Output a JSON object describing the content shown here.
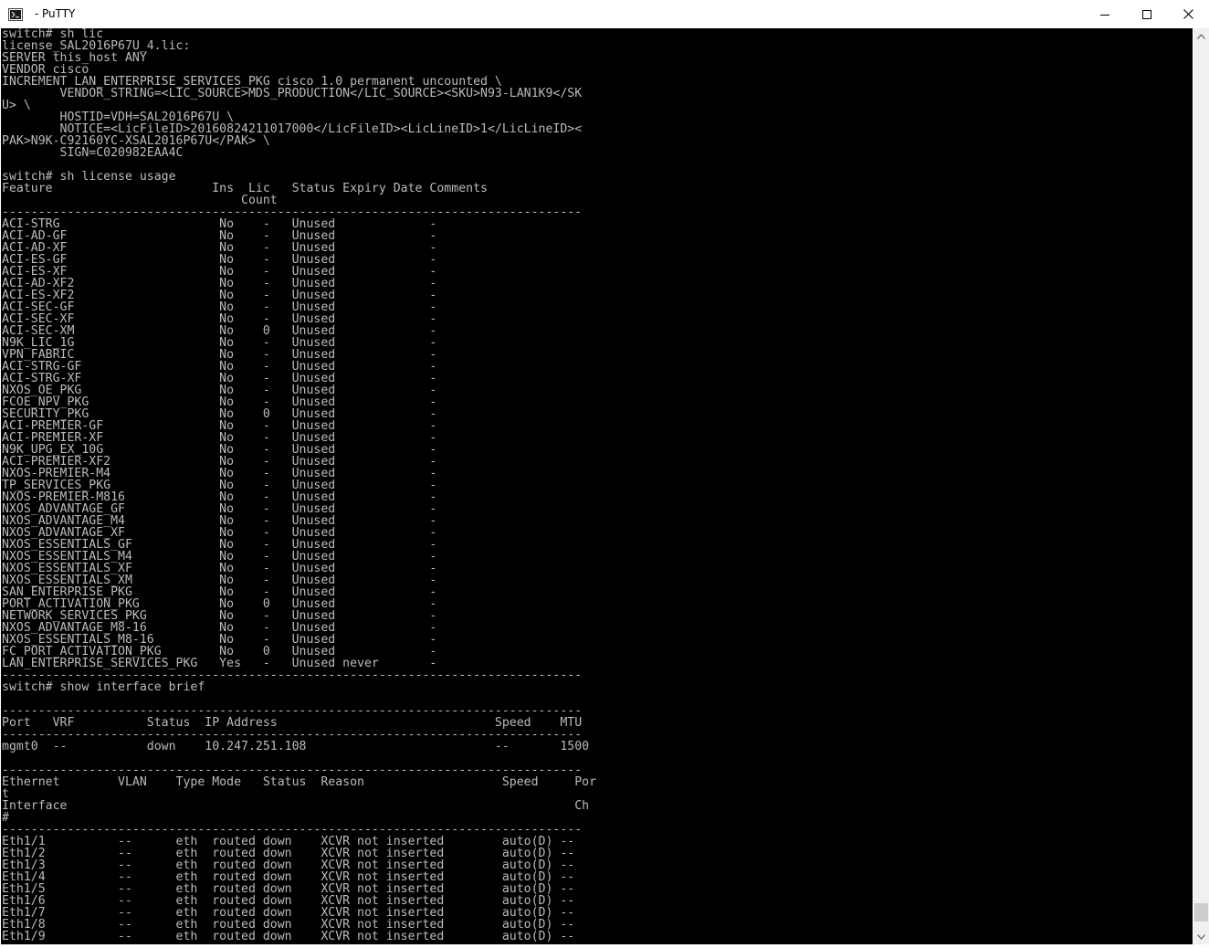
{
  "window": {
    "title": " - PuTTY",
    "app_icon": "putty-terminal-icon",
    "controls": {
      "minimize_icon": "minimize-icon",
      "maximize_icon": "maximize-icon",
      "close_icon": "close-icon"
    }
  },
  "colors": {
    "terminal_bg": "#000000",
    "terminal_fg": "#bbbbbb",
    "titlebar_bg": "#ffffff",
    "scrollbar_bg": "#f0f0f0",
    "scrollbar_thumb": "#cdcdcd"
  },
  "scrollbar": {
    "up_icon": "scroll-up-arrow-icon",
    "down_icon": "scroll-down-arrow-icon",
    "thumb_position_fraction": 0.97
  },
  "terminal": {
    "lines": [
      "switch# sh lic",
      "license_SAL2016P67U_4.lic:",
      "SERVER this_host ANY",
      "VENDOR cisco",
      "INCREMENT LAN_ENTERPRISE_SERVICES_PKG cisco 1.0 permanent uncounted \\",
      "        VENDOR_STRING=<LIC_SOURCE>MDS_PRODUCTION</LIC_SOURCE><SKU>N93-LAN1K9</SK",
      "U> \\",
      "        HOSTID=VDH=SAL2016P67U \\",
      "        NOTICE=<LicFileID>20160824211017000</LicFileID><LicLineID>1</LicLineID><",
      "PAK>N9K-C92160YC-XSAL2016P67U</PAK> \\",
      "        SIGN=C020982EAA4C",
      "",
      "switch# sh license usage",
      "Feature                      Ins  Lic   Status Expiry Date Comments",
      "                                 Count",
      "--------------------------------------------------------------------------------",
      "ACI-STRG                      No    -   Unused             -",
      "ACI-AD-GF                     No    -   Unused             -",
      "ACI-AD-XF                     No    -   Unused             -",
      "ACI-ES-GF                     No    -   Unused             -",
      "ACI-ES-XF                     No    -   Unused             -",
      "ACI-AD-XF2                    No    -   Unused             -",
      "ACI-ES-XF2                    No    -   Unused             -",
      "ACI-SEC-GF                    No    -   Unused             -",
      "ACI-SEC-XF                    No    -   Unused             -",
      "ACI-SEC-XM                    No    0   Unused             -",
      "N9K_LIC_1G                    No    -   Unused             -",
      "VPN_FABRIC                    No    -   Unused             -",
      "ACI-STRG-GF                   No    -   Unused             -",
      "ACI-STRG-XF                   No    -   Unused             -",
      "NXOS_OE_PKG                   No    -   Unused             -",
      "FCOE_NPV_PKG                  No    -   Unused             -",
      "SECURITY_PKG                  No    0   Unused             -",
      "ACI-PREMIER-GF                No    -   Unused             -",
      "ACI-PREMIER-XF                No    -   Unused             -",
      "N9K_UPG_EX_10G                No    -   Unused             -",
      "ACI-PREMIER-XF2               No    -   Unused             -",
      "NXOS-PREMIER-M4               No    -   Unused             -",
      "TP_SERVICES_PKG               No    -   Unused             -",
      "NXOS-PREMIER-M816             No    -   Unused             -",
      "NXOS_ADVANTAGE_GF             No    -   Unused             -",
      "NXOS_ADVANTAGE_M4             No    -   Unused             -",
      "NXOS_ADVANTAGE_XF             No    -   Unused             -",
      "NXOS_ESSENTIALS_GF            No    -   Unused             -",
      "NXOS_ESSENTIALS_M4            No    -   Unused             -",
      "NXOS_ESSENTIALS_XF            No    -   Unused             -",
      "NXOS_ESSENTIALS_XM            No    -   Unused             -",
      "SAN_ENTERPRISE_PKG            No    -   Unused             -",
      "PORT_ACTIVATION_PKG           No    0   Unused             -",
      "NETWORK_SERVICES_PKG          No    -   Unused             -",
      "NXOS_ADVANTAGE_M8-16          No    -   Unused             -",
      "NXOS_ESSENTIALS_M8-16         No    -   Unused             -",
      "FC_PORT_ACTIVATION_PKG        No    0   Unused             -",
      "LAN_ENTERPRISE_SERVICES_PKG   Yes   -   Unused never       -",
      "--------------------------------------------------------------------------------",
      "switch# show interface brief",
      "",
      "--------------------------------------------------------------------------------",
      "Port   VRF          Status  IP Address                              Speed    MTU",
      "--------------------------------------------------------------------------------",
      "mgmt0  --           down    10.247.251.108                          --       1500",
      "",
      "--------------------------------------------------------------------------------",
      "Ethernet        VLAN    Type Mode   Status  Reason                   Speed     Por",
      "t",
      "Interface                                                                      Ch",
      "#",
      "--------------------------------------------------------------------------------",
      "Eth1/1          --      eth  routed down    XCVR not inserted        auto(D) --",
      "Eth1/2          --      eth  routed down    XCVR not inserted        auto(D) --",
      "Eth1/3          --      eth  routed down    XCVR not inserted        auto(D) --",
      "Eth1/4          --      eth  routed down    XCVR not inserted        auto(D) --",
      "Eth1/5          --      eth  routed down    XCVR not inserted        auto(D) --",
      "Eth1/6          --      eth  routed down    XCVR not inserted        auto(D) --",
      "Eth1/7          --      eth  routed down    XCVR not inserted        auto(D) --",
      "Eth1/8          --      eth  routed down    XCVR not inserted        auto(D) --",
      "Eth1/9          --      eth  routed down    XCVR not inserted        auto(D) --"
    ]
  }
}
